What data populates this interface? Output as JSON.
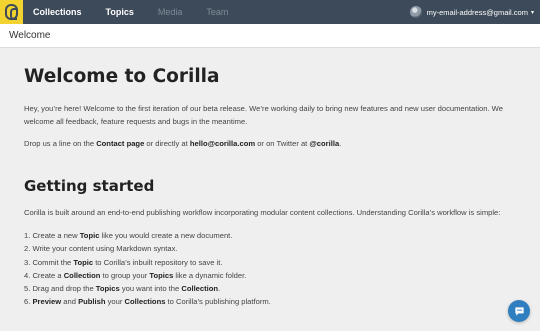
{
  "nav": {
    "items": [
      "Collections",
      "Topics",
      "Media",
      "Team"
    ]
  },
  "account": {
    "email": "my-email-address@gmail.com"
  },
  "subheader": {
    "title": "Welcome"
  },
  "main": {
    "title": "Welcome to Corilla",
    "intro": "Hey, you’re here! Welcome to the first iteration of our beta release. We’re working daily to bring new features and new user documentation. We welcome all feedback, feature requests and bugs in the meantime.",
    "contact": {
      "t1": "Drop us a line on the ",
      "page_link": "Contact page",
      "t2": " or directly at ",
      "email": "hello@corilla.com",
      "t3": " or on Twitter at ",
      "twitter": "@corilla",
      "t4": "."
    },
    "section_title": "Getting started",
    "section_intro": "Corilla is built around an end-to-end publishing workflow incorporating modular content collections. Understanding Corilla’s workflow is simple:",
    "steps": [
      {
        "num": "1. ",
        "a": "Create a new ",
        "b": "Topic",
        "c": " like you would create a new document."
      },
      {
        "num": "2. ",
        "a": "Write your content using Markdown syntax."
      },
      {
        "num": "3. ",
        "a": "Commit the ",
        "b": "Topic",
        "c": " to Corilla’s inbuilt repository to save it."
      },
      {
        "num": "4. ",
        "a": "Create a ",
        "b": "Collection",
        "c": " to group your ",
        "d": "Topics",
        "e": " like a dynamic folder."
      },
      {
        "num": "5. ",
        "a": "Drag and drop the ",
        "b": "Topics",
        "c": " you want into the ",
        "d": "Collection",
        "e": "."
      },
      {
        "num": "6. ",
        "b": "Preview",
        "c": " and ",
        "d": "Publish",
        "e": " your ",
        "f": "Collections",
        "g": " to Corilla’s publishing platform."
      }
    ]
  },
  "colors": {
    "topbar": "#3c4a59",
    "logo": "#f2d22e",
    "chat": "#2f7fc0"
  },
  "icons": {
    "logo": "corilla-logo-icon",
    "chat": "chat-bubble-icon",
    "dropdown": "chevron-down-icon"
  }
}
